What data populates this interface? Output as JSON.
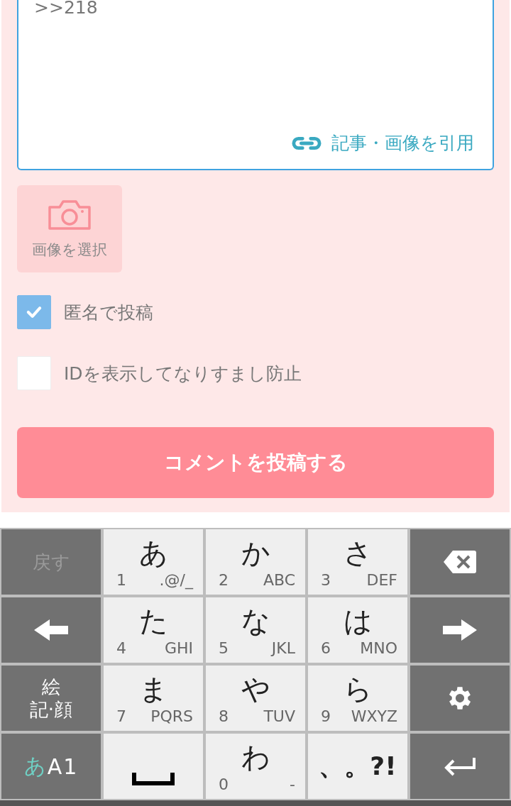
{
  "comment_form": {
    "textarea": {
      "value": ">>218"
    },
    "quote_link": "記事・画像を引用",
    "image_button": "画像を選択",
    "options": [
      {
        "label": "匿名で投稿",
        "checked": true
      },
      {
        "label": "IDを表示してなりすまし防止",
        "checked": false
      }
    ],
    "submit": "コメントを投稿する"
  },
  "keyboard": {
    "keys": [
      {
        "kind": "text",
        "lines": [
          "戻す"
        ],
        "disabled": true
      },
      {
        "kind": "kana",
        "main": "あ",
        "digit": "1",
        "letters": ".@/_"
      },
      {
        "kind": "kana",
        "main": "か",
        "digit": "2",
        "letters": "ABC"
      },
      {
        "kind": "kana",
        "main": "さ",
        "digit": "3",
        "letters": "DEF"
      },
      {
        "kind": "backspace"
      },
      {
        "kind": "left"
      },
      {
        "kind": "kana",
        "main": "た",
        "digit": "4",
        "letters": "GHI"
      },
      {
        "kind": "kana",
        "main": "な",
        "digit": "5",
        "letters": "JKL"
      },
      {
        "kind": "kana",
        "main": "は",
        "digit": "6",
        "letters": "MNO"
      },
      {
        "kind": "right"
      },
      {
        "kind": "text",
        "lines": [
          "絵",
          "記·顔"
        ],
        "disabled": false
      },
      {
        "kind": "kana",
        "main": "ま",
        "digit": "7",
        "letters": "PQRS"
      },
      {
        "kind": "kana",
        "main": "や",
        "digit": "8",
        "letters": "TUV"
      },
      {
        "kind": "kana",
        "main": "ら",
        "digit": "9",
        "letters": "WXYZ"
      },
      {
        "kind": "settings"
      },
      {
        "kind": "mode",
        "active": "あ",
        "rest": "A1"
      },
      {
        "kind": "space"
      },
      {
        "kind": "kana",
        "main": "わ",
        "digit": "0",
        "letters": "-"
      },
      {
        "kind": "punct",
        "label": "、。?!"
      },
      {
        "kind": "enter"
      }
    ]
  }
}
